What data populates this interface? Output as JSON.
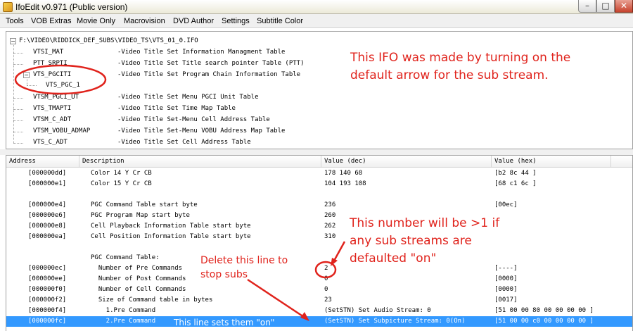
{
  "window": {
    "title": "IfoEdit v0.971 (Public version)",
    "minimize": "–",
    "maximize": "□",
    "close": "✕"
  },
  "menu": [
    "Tools",
    "VOB Extras",
    "Movie Only",
    "Macrovision",
    "DVD Author",
    "Settings",
    "Subtitle Color"
  ],
  "tree": {
    "root": "F:\\VIDEO\\RIDDICK_DEF_SUBS\\VIDEO_TS\\VTS_01_0.IFO",
    "items": [
      {
        "name": "VTSI_MAT",
        "desc": "-Video Title Set Information Managment Table"
      },
      {
        "name": "PTT_SRPTI",
        "desc": "-Video Title Set Title search pointer Table (PTT)"
      },
      {
        "name": "VTS_PGCITI",
        "desc": "-Video Title Set Program Chain Information Table"
      },
      {
        "name": "VTS_PGC_1",
        "desc": ""
      },
      {
        "name": "VTSM_PGCI_UT",
        "desc": "-Video Title Set Menu PGCI Unit Table"
      },
      {
        "name": "VTS_TMAPTI",
        "desc": "-Video Title Set Time Map Table"
      },
      {
        "name": "VTSM_C_ADT",
        "desc": "-Video Title Set-Menu Cell Address Table"
      },
      {
        "name": "VTSM_VOBU_ADMAP",
        "desc": "-Video Title Set-Menu VOBU Address Map Table"
      },
      {
        "name": "VTS_C_ADT",
        "desc": "-Video Title Set Cell Address Table"
      }
    ]
  },
  "list": {
    "columns": [
      "Address",
      "Description",
      "Value (dec)",
      "Value (hex)"
    ],
    "rows": [
      {
        "addr": "[000000dd]",
        "desc": "Color 14 Y Cr CB",
        "dec": "178 140 68",
        "hex": "[b2 8c 44 ]"
      },
      {
        "addr": "[000000e1]",
        "desc": "Color 15 Y Cr CB",
        "dec": "104 193 108",
        "hex": "[68 c1 6c ]"
      },
      {
        "addr": "",
        "desc": "",
        "dec": "",
        "hex": ""
      },
      {
        "addr": "[000000e4]",
        "desc": "PGC Command Table start byte",
        "dec": "236",
        "hex": "[00ec]"
      },
      {
        "addr": "[000000e6]",
        "desc": "PGC Program Map start byte",
        "dec": "260",
        "hex": ""
      },
      {
        "addr": "[000000e8]",
        "desc": "Cell Playback Information Table start byte",
        "dec": "262",
        "hex": ""
      },
      {
        "addr": "[000000ea]",
        "desc": "Cell Position Information Table start byte",
        "dec": "310",
        "hex": ""
      },
      {
        "addr": "",
        "desc": "",
        "dec": "",
        "hex": ""
      },
      {
        "addr": "",
        "desc": "PGC Command Table:",
        "dec": "",
        "hex": ""
      },
      {
        "addr": "[000000ec]",
        "desc": "  Number of Pre Commands",
        "dec": "2",
        "hex": "[----]"
      },
      {
        "addr": "[000000ee]",
        "desc": "  Number of Post Commands",
        "dec": "0",
        "hex": "[0000]"
      },
      {
        "addr": "[000000f0]",
        "desc": "  Number of Cell Commands",
        "dec": "0",
        "hex": "[0000]"
      },
      {
        "addr": "[000000f2]",
        "desc": "  Size of Command table in bytes",
        "dec": "23",
        "hex": "[0017]"
      },
      {
        "addr": "[000000f4]",
        "desc": "    1.Pre Command",
        "dec": "(SetSTN) Set Audio Stream: 0",
        "hex": "[51 00 00 80 00 00 00 00 ]"
      },
      {
        "addr": "[000000fc]",
        "desc": "    2.Pre Command",
        "dec": "(SetSTN) Set Subpicture Stream: 0(On)",
        "hex": "[51 00 00 c0 00 00 00 00 ]"
      }
    ],
    "selected_index": 14
  },
  "annotations": {
    "top_note_1": "This IFO was made by turning on the",
    "top_note_2": "default arrow for the sub stream.",
    "num_note_1": "This number will be >1 if",
    "num_note_2": "any sub streams are",
    "num_note_3": "defaulted \"on\"",
    "delete_note_1": "Delete this line to",
    "delete_note_2": "stop subs",
    "sets_on_note": "This line sets them \"on\"",
    "color": "#e0231c"
  }
}
